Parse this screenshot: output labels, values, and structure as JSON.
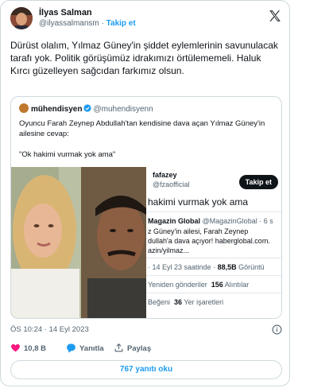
{
  "author": {
    "name": "İlyas Salman",
    "handle": "@ilyassalmansm",
    "separator": "·",
    "follow_label": "Takip et"
  },
  "tweet": {
    "text": "Dürüst olalım, Yılmaz Güney'in şiddet eylemlerinin savunulacak tarafı yok. Politik görüşümüz idrakımızı örtülememeli. Haluk Kırcı güzelleyen sağcıdan farkımız olsun.",
    "timestamp": "ÖS 10:24 · 14 Eyl 2023"
  },
  "quoted": {
    "name": "mühendisyen",
    "handle": "@muhendisyenn",
    "text": "Oyuncu Farah Zeynep Abdullah'tan kendisine dava açan Yılmaz Güney'in ailesine cevap:",
    "quote_line": "\"Ok hakimi vurmak yok ama\""
  },
  "screenshot": {
    "name": "fafazey",
    "handle": "@fzaofficial",
    "follow_label": "Takip et",
    "tweet_text": "hakimi vurmak yok ama",
    "source_name": "Magazin Global",
    "source_handle": "@MagazinGlobal · 6 s",
    "source_line1": "z Güney'in ailesi, Farah Zeynep",
    "source_line2": "dullah'a dava açıyor! haberglobal.com.",
    "source_line3": "azin/yilmaz...",
    "time": "· 14 Eyl 23 saatinde · ",
    "views": "88,5B",
    "views_label": "Görüntü",
    "reposts_label": "Yeniden gönderiler",
    "reposts": "156",
    "quotes_label": "Alıntılar",
    "likes_label": "Beğeni",
    "bookmarks": "36",
    "bookmarks_label": "Yer işaretleri"
  },
  "actions": {
    "likes": "10,8 B",
    "reply_label": "Yanıtla",
    "share_label": "Paylaş"
  },
  "replies_button": "767 yanıtı oku",
  "colors": {
    "accent": "#1d9bf0",
    "like": "#f91880",
    "text": "#0f1419",
    "muted": "#536471",
    "border": "#cfd9de"
  },
  "icons": [
    "x-logo-icon",
    "verified-icon",
    "info-icon",
    "heart-icon",
    "reply-icon",
    "share-icon"
  ]
}
